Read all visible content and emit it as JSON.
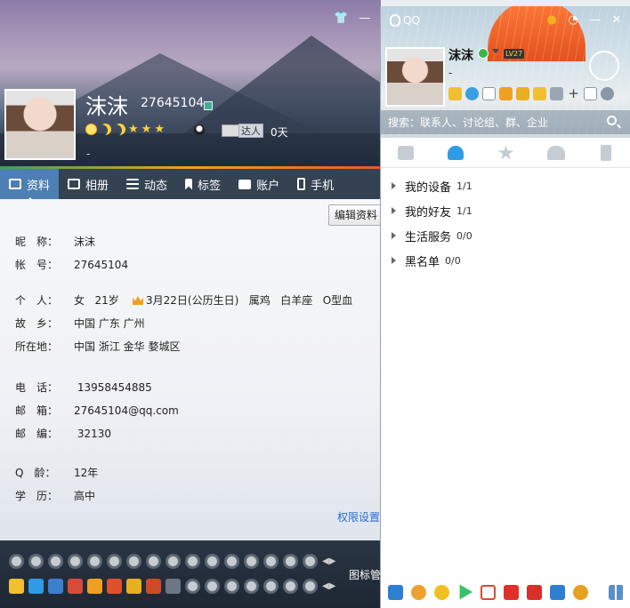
{
  "profile": {
    "name": "沫沫",
    "qq_number": "27645104",
    "talent_label": "达人",
    "talent_days": "0天",
    "signature": "-",
    "edit_button": "编辑资料",
    "tabs": [
      {
        "label": "资料",
        "icon": "id-card-icon"
      },
      {
        "label": "相册",
        "icon": "photo-icon"
      },
      {
        "label": "动态",
        "icon": "list-icon"
      },
      {
        "label": "标签",
        "icon": "bookmark-icon"
      },
      {
        "label": "账户",
        "icon": "wallet-icon"
      },
      {
        "label": "手机",
        "icon": "phone-icon"
      }
    ],
    "fields": {
      "nickname": {
        "label": "昵　称：",
        "value": "沫沫"
      },
      "account": {
        "label": "帐　号：",
        "value": "27645104"
      },
      "personal": {
        "label": "个　人：",
        "gender": "女",
        "age": "21岁",
        "birthday": "3月22日(公历生日)",
        "zodiac": "属鸡",
        "constellation": "白羊座",
        "blood": "O型血"
      },
      "hometown": {
        "label": "故　乡：",
        "value": "中国 广东 广州"
      },
      "location": {
        "label": "所在地：",
        "value": "中国 浙江 金华 婺城区"
      },
      "phone": {
        "label": "电　话：",
        "value": "13958454885"
      },
      "email": {
        "label": "邮　箱：",
        "value": "27645104@qq.com"
      },
      "postcode": {
        "label": "邮　编：",
        "value": "32130"
      },
      "qage": {
        "label": "Q　龄：",
        "value": "12年"
      },
      "education": {
        "label": "学　历：",
        "value": "高中"
      }
    },
    "permissions_link": "权限设置",
    "icon_manage": "图标管"
  },
  "qq": {
    "app_name": "QQ",
    "name": "沫沫",
    "level_badge": "LV27",
    "signature": "-",
    "search_placeholder": "搜索：联系人、讨论组、群、企业",
    "tabs": [
      {
        "name": "messages",
        "icon": "chat-icon"
      },
      {
        "name": "contacts",
        "icon": "contact-icon",
        "active": true
      },
      {
        "name": "favorites",
        "icon": "star-icon"
      },
      {
        "name": "groups",
        "icon": "group-icon"
      },
      {
        "name": "mobile",
        "icon": "phone-icon"
      }
    ],
    "groups": [
      {
        "label": "我的设备",
        "count": "1/1"
      },
      {
        "label": "我的好友",
        "count": "1/1"
      },
      {
        "label": "生活服务",
        "count": "0/0"
      },
      {
        "label": "黑名单",
        "count": "0/0"
      }
    ]
  },
  "colors": {
    "active_tab": "#4d7fb5",
    "link": "#2a6ad0",
    "qq_accent": "#2e9be6"
  }
}
